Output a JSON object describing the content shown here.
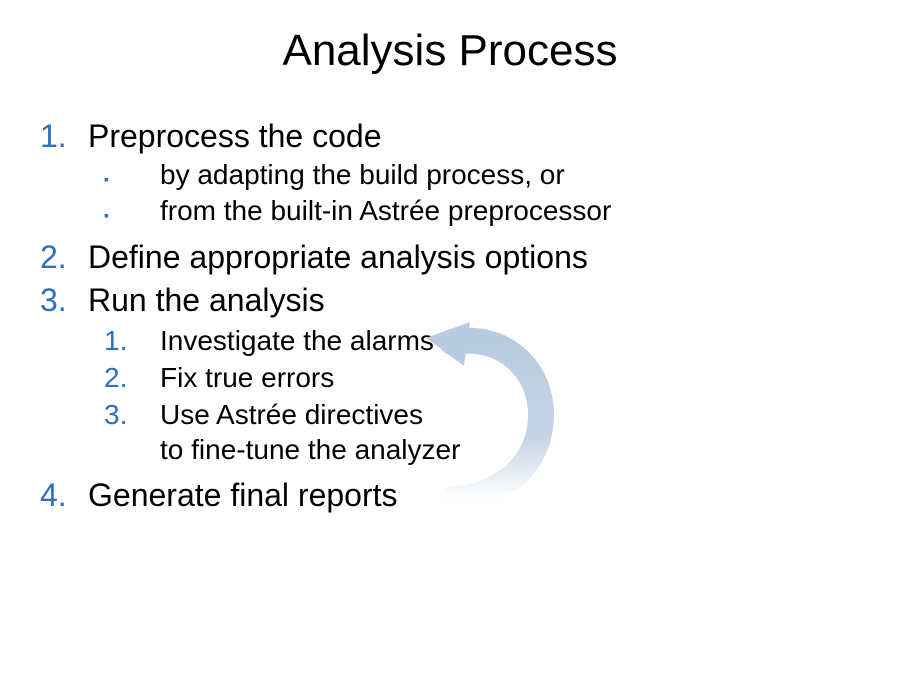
{
  "title": "Analysis Process",
  "items": {
    "i1": {
      "num": "1.",
      "text": "Preprocess the code"
    },
    "i1a": {
      "text": "by adapting the build process, or"
    },
    "i1b": {
      "text": "from the built-in Astrée preprocessor"
    },
    "i2": {
      "num": "2.",
      "text": "Define appropriate analysis options"
    },
    "i3": {
      "num": "3.",
      "text": "Run the analysis"
    },
    "i3a": {
      "num": "1.",
      "text": "Investigate the alarms"
    },
    "i3b": {
      "num": "2.",
      "text": "Fix true errors"
    },
    "i3c": {
      "num": "3.",
      "text": "Use Astrée directives\nto fine-tune the analyzer"
    },
    "i4": {
      "num": "4.",
      "text": "Generate final reports"
    }
  },
  "colors": {
    "numbered": "#2f6fbf",
    "arrow": "#b9ccdf"
  }
}
